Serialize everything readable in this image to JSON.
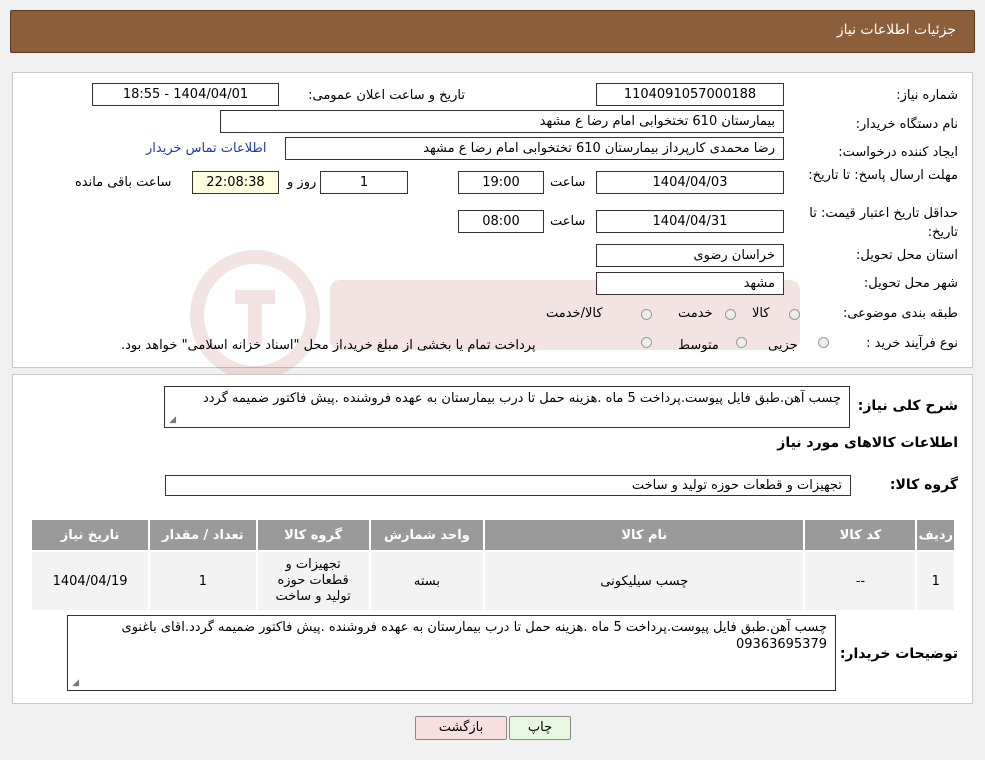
{
  "header": {
    "title": "جزئيات اطلاعات نياز"
  },
  "form": {
    "need_number_label": "شماره نیاز:",
    "need_number": "1104091057000188",
    "announce_label": "تاریخ و ساعت اعلان عمومی:",
    "announce_value": "1404/04/01 - 18:55",
    "buyer_label": "نام دستگاه خریدار:",
    "buyer_value": "بیمارستان 610 تختخوابی امام رضا ع  مشهد",
    "creator_label": "ایجاد کننده درخواست:",
    "creator_value": "رضا محمدی کارپرداز بیمارستان 610 تختخوابی امام رضا ع  مشهد",
    "contact_link": "اطلاعات تماس خریدار",
    "deadline_label": "مهلت ارسال پاسخ: تا تاریخ:",
    "deadline_date": "1404/04/03",
    "time_label": "ساعت",
    "deadline_time": "19:00",
    "days_value": "1",
    "days_label": "روز و",
    "remaining_value": "22:08:38",
    "remaining_label": "ساعت باقی مانده",
    "validity_label": "حداقل تاریخ اعتبار قیمت: تا تاریخ:",
    "validity_date": "1404/04/31",
    "validity_time": "08:00",
    "province_label": "استان محل تحویل:",
    "province_value": "خراسان رضوی",
    "city_label": "شهر محل تحویل:",
    "city_value": "مشهد",
    "category_label": "طبقه بندی موضوعی:",
    "category_options": [
      "کالا",
      "خدمت",
      "کالا/خدمت"
    ],
    "process_label": "نوع فرآیند خرید :",
    "process_options": [
      "جزیی",
      "متوسط"
    ],
    "process_note": "پرداخت تمام یا بخشی از مبلغ خرید،از محل \"اسناد خزانه اسلامی\" خواهد بود."
  },
  "details": {
    "summary_label": "شرح کلی نیاز:",
    "summary_text": "چسب آهن.طبق فایل پیوست.پرداخت 5 ماه .هزینه حمل تا درب بیمارستان به عهده فروشنده .پیش فاکتور ضمیمه گردد",
    "goods_title": "اطلاعات کالاهای مورد نیاز",
    "group_label": "گروه کالا:",
    "group_value": "تجهیزات و قطعات حوزه تولید و ساخت",
    "table": {
      "headers": [
        "ردیف",
        "کد کالا",
        "نام کالا",
        "واحد شمارش",
        "گروه کالا",
        "تعداد / مقدار",
        "تاریخ نیاز"
      ],
      "rows": [
        [
          "1",
          "--",
          "چسب سیلیکونی",
          "بسته",
          "تجهیزات و قطعات حوزه تولید و ساخت",
          "1",
          "1404/04/19"
        ]
      ]
    },
    "buyer_notes_label": "توضیحات خریدار:",
    "buyer_notes_text": "چسب آهن.طبق فایل پیوست.پرداخت 5 ماه .هزینه حمل تا درب بیمارستان به عهده فروشنده .پیش فاکتور ضمیمه گردد.اقای باغنوی 09363695379"
  },
  "buttons": {
    "print": "چاپ",
    "back": "بازگشت"
  },
  "colors": {
    "header": "#8b5e3c",
    "link": "#1f3fa0",
    "table_header": "#9a9a9a",
    "back_button": "#f8dede",
    "print_button": "#e8f8e0"
  }
}
